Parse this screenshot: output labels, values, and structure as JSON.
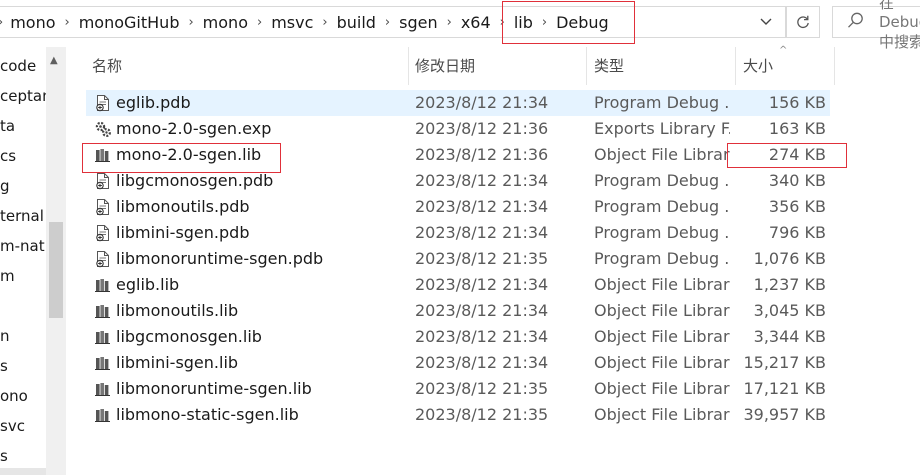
{
  "address_bar": {
    "crumbs": [
      "mono",
      "monoGitHub",
      "mono",
      "msvc",
      "build",
      "sgen",
      "x64",
      "lib",
      "Debug"
    ],
    "search_placeholder": "在 Debug 中搜索",
    "refresh_icon": "refresh-icon",
    "dropdown_icon": "chevron-down-icon"
  },
  "nav_pane": {
    "items": [
      "code",
      "ceptan",
      "ta",
      "cs",
      "g",
      "ternal",
      "m-nati",
      "m",
      "",
      "n",
      "s",
      "ono",
      "svc",
      "s"
    ]
  },
  "columns": {
    "name": "名称",
    "date": "修改日期",
    "type": "类型",
    "size": "大小"
  },
  "files": [
    {
      "name": "eglib.pdb",
      "date": "2023/8/12 21:34",
      "type": "Program Debug ...",
      "size": "156 KB",
      "icon": "pdb-file-icon"
    },
    {
      "name": "mono-2.0-sgen.exp",
      "date": "2023/8/12 21:36",
      "type": "Exports Library F...",
      "size": "163 KB",
      "icon": "exp-file-icon"
    },
    {
      "name": "mono-2.0-sgen.lib",
      "date": "2023/8/12 21:36",
      "type": "Object File Library",
      "size": "274 KB",
      "icon": "lib-file-icon"
    },
    {
      "name": "libgcmonosgen.pdb",
      "date": "2023/8/12 21:34",
      "type": "Program Debug ...",
      "size": "340 KB",
      "icon": "pdb-file-icon"
    },
    {
      "name": "libmonoutils.pdb",
      "date": "2023/8/12 21:34",
      "type": "Program Debug ...",
      "size": "356 KB",
      "icon": "pdb-file-icon"
    },
    {
      "name": "libmini-sgen.pdb",
      "date": "2023/8/12 21:34",
      "type": "Program Debug ...",
      "size": "796 KB",
      "icon": "pdb-file-icon"
    },
    {
      "name": "libmonoruntime-sgen.pdb",
      "date": "2023/8/12 21:35",
      "type": "Program Debug ...",
      "size": "1,076 KB",
      "icon": "pdb-file-icon"
    },
    {
      "name": "eglib.lib",
      "date": "2023/8/12 21:34",
      "type": "Object File Library",
      "size": "1,237 KB",
      "icon": "lib-file-icon"
    },
    {
      "name": "libmonoutils.lib",
      "date": "2023/8/12 21:34",
      "type": "Object File Library",
      "size": "3,045 KB",
      "icon": "lib-file-icon"
    },
    {
      "name": "libgcmonosgen.lib",
      "date": "2023/8/12 21:34",
      "type": "Object File Library",
      "size": "3,344 KB",
      "icon": "lib-file-icon"
    },
    {
      "name": "libmini-sgen.lib",
      "date": "2023/8/12 21:34",
      "type": "Object File Library",
      "size": "15,217 KB",
      "icon": "lib-file-icon"
    },
    {
      "name": "libmonoruntime-sgen.lib",
      "date": "2023/8/12 21:35",
      "type": "Object File Library",
      "size": "17,121 KB",
      "icon": "lib-file-icon"
    },
    {
      "name": "libmono-static-sgen.lib",
      "date": "2023/8/12 21:35",
      "type": "Object File Library",
      "size": "39,957 KB",
      "icon": "lib-file-icon"
    }
  ],
  "selected_row": 0,
  "colors": {
    "highlight_box": "#e0303a",
    "selection_bg": "#e5f3ff"
  }
}
